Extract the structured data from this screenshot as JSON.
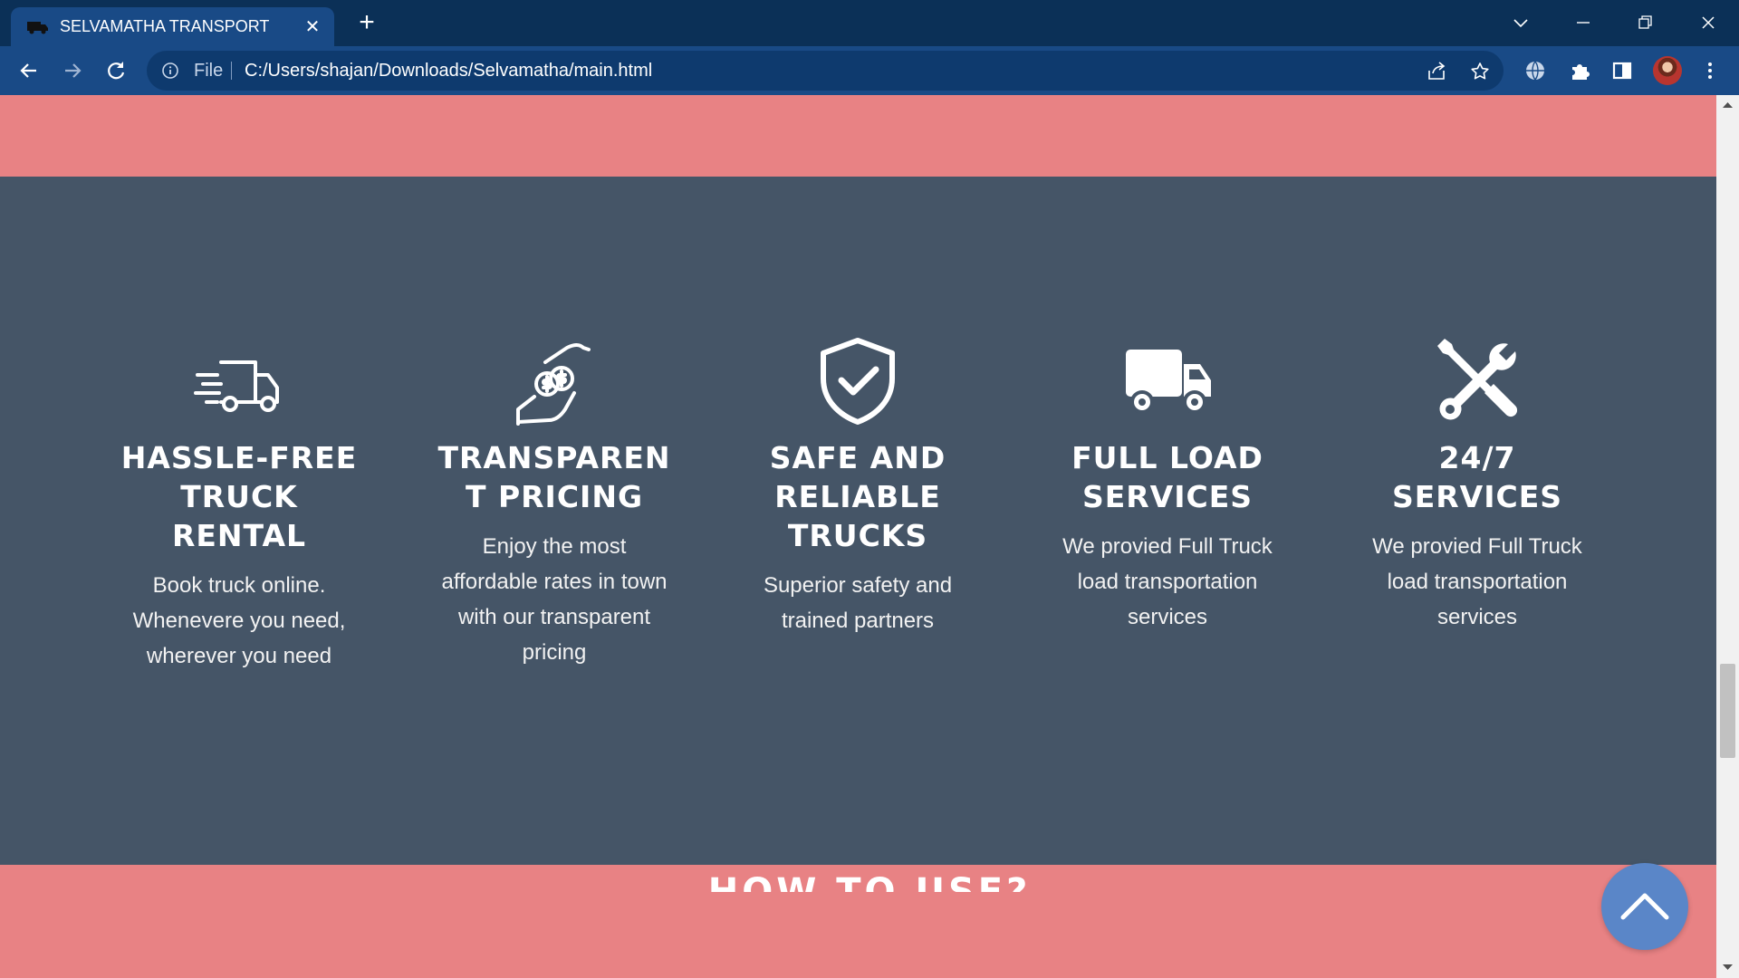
{
  "browser": {
    "tab_title": "SELVAMATHA TRANSPORT",
    "tab_close_glyph": "✕",
    "new_tab_glyph": "+",
    "address_scheme_label": "File",
    "address_url": "C:/Users/shajan/Downloads/Selvamatha/main.html"
  },
  "features": [
    {
      "icon": "fast-delivery-truck-icon",
      "title": "HASSLE-FREE TRUCK RENTAL",
      "description": "Book truck online. Whenevere you need, wherever you need"
    },
    {
      "icon": "money-hand-icon",
      "title": "TRANSPAREN T PRICING",
      "description": "Enjoy the most affordable rates in town with our transparent pricing"
    },
    {
      "icon": "shield-check-icon",
      "title": "SAFE AND RELIABLE TRUCKS",
      "description": "Superior safety and trained partners"
    },
    {
      "icon": "truck-icon",
      "title": "FULL LOAD SERVICES",
      "description": "We provied Full Truck load transportation services"
    },
    {
      "icon": "tools-icon",
      "title": "24/7 SERVICES",
      "description": "We provied Full Truck load transportation services"
    }
  ],
  "next_section_heading": "HOW TO USE?",
  "colors": {
    "accent_pink": "#e88284",
    "section_slate": "#455567",
    "scroll_top_blue": "#5a86c8",
    "browser_frame": "#0b3057",
    "browser_toolbar": "#194a86"
  }
}
